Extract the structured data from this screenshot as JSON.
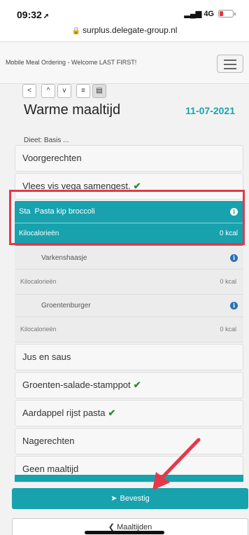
{
  "status": {
    "time": "09:32",
    "network": "4G"
  },
  "browser": {
    "url": "surplus.delegate-group.nl"
  },
  "header": {
    "title": "Mobile Meal Ordering - Welcome LAST FIRST!"
  },
  "page": {
    "title": "Warme maaltijd",
    "date": "11-07-2021",
    "diet": "Dieet: Basis ..."
  },
  "categories": {
    "voorgerechten": "Voorgerechten",
    "vlees": "Vlees vis vega samengest.",
    "jus": "Jus en saus",
    "groenten": "Groenten-salade-stamppot",
    "aardappel": "Aardappel rijst pasta",
    "nagerechten": "Nagerechten",
    "geen": "Geen maaltijd"
  },
  "selected_item": {
    "code": "Sta",
    "name": "Pasta kip broccoli",
    "kcal_label": "Kilocalorieën",
    "kcal_value": "0 kcal"
  },
  "sub_items": [
    {
      "name": "Varkenshaasje",
      "kcal_label": "Kilocalorieën",
      "kcal_value": "0 kcal"
    },
    {
      "name": "Groentenburger",
      "kcal_label": "Kilocalorieën",
      "kcal_value": "0 kcal"
    }
  ],
  "buttons": {
    "confirm": "Bevestig",
    "back": "Maaltijden"
  },
  "icons": {
    "info": "info-icon",
    "check": "check-icon",
    "send": "send-icon",
    "back": "chevron-left-icon"
  },
  "colors": {
    "accent": "#17a2ad",
    "highlight": "#e5384a",
    "check": "#2e8b2e"
  }
}
